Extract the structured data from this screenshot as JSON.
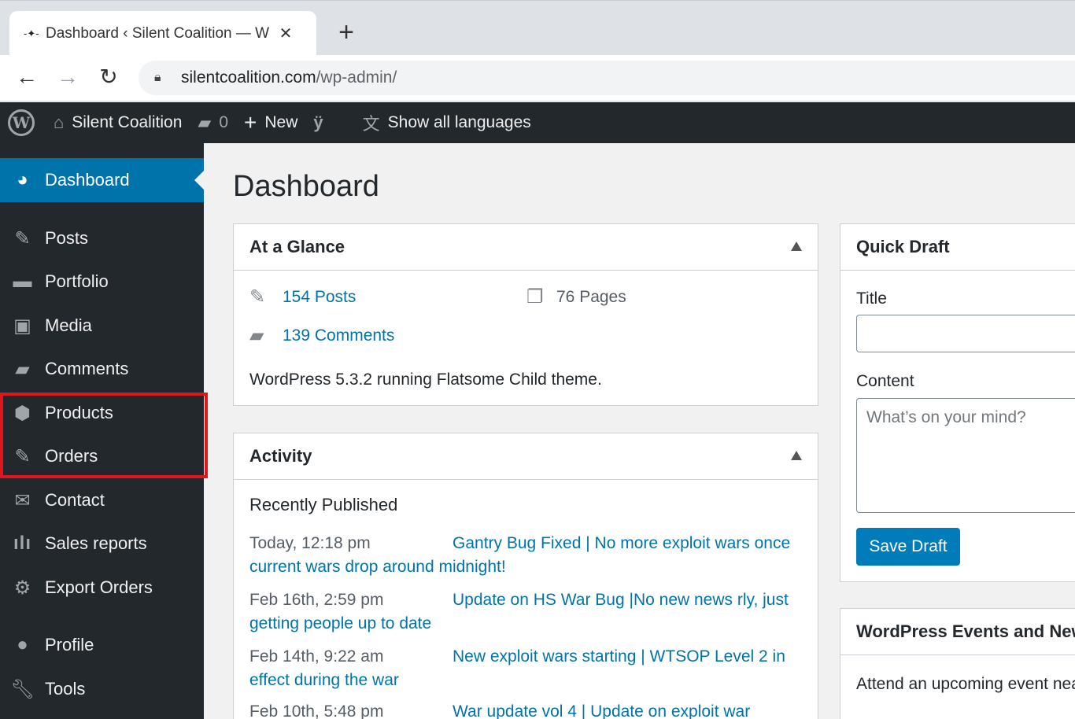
{
  "browser": {
    "tab_title": "Dashboard ‹ Silent Coalition — W",
    "url_host": "silentcoalition.com",
    "url_path": "/wp-admin/"
  },
  "adminbar": {
    "site_name": "Silent Coalition",
    "comments_count": "0",
    "new_label": "New",
    "languages_label": "Show all languages"
  },
  "sidebar": {
    "items": [
      {
        "label": "Dashboard",
        "icon": "dashboard-icon"
      },
      {
        "label": "Posts",
        "icon": "pin-icon"
      },
      {
        "label": "Portfolio",
        "icon": "folder-icon"
      },
      {
        "label": "Media",
        "icon": "media-icon"
      },
      {
        "label": "Comments",
        "icon": "comment-icon"
      },
      {
        "label": "Products",
        "icon": "box-icon"
      },
      {
        "label": "Orders",
        "icon": "pin-icon"
      },
      {
        "label": "Contact",
        "icon": "envelope-icon"
      },
      {
        "label": "Sales reports",
        "icon": "bar-chart-icon"
      },
      {
        "label": "Export Orders",
        "icon": "gear-icon"
      },
      {
        "label": "Profile",
        "icon": "user-icon"
      },
      {
        "label": "Tools",
        "icon": "wrench-icon"
      }
    ]
  },
  "main": {
    "page_title": "Dashboard",
    "glance": {
      "title": "At a Glance",
      "posts": "154 Posts",
      "pages": "76 Pages",
      "comments": "139 Comments",
      "version_text": "WordPress 5.3.2 running Flatsome Child theme."
    },
    "activity": {
      "title": "Activity",
      "subtitle": "Recently Published",
      "items": [
        {
          "date": "Today, 12:18 pm",
          "title_line1": "Gantry Bug Fixed | No more exploit wars once",
          "title_line2": "current wars drop around midnight!"
        },
        {
          "date": "Feb 16th, 2:59 pm",
          "title_line1": "Update on HS War Bug |No new news rly, just",
          "title_line2": "getting people up to date"
        },
        {
          "date": "Feb 14th, 9:22 am",
          "title_line1": "New exploit wars starting | WTSOP Level 2 in",
          "title_line2": "effect during the war"
        },
        {
          "date": "Feb 10th, 5:48 pm",
          "title_line1": "War update vol 4 | Update on exploit war",
          "title_line2": ""
        }
      ]
    },
    "quick_draft": {
      "title": "Quick Draft",
      "title_label": "Title",
      "title_value": "",
      "content_label": "Content",
      "content_placeholder": "What’s on your mind?",
      "save_label": "Save Draft"
    },
    "events": {
      "title": "WordPress Events and News",
      "text": "Attend an upcoming event near you."
    }
  }
}
